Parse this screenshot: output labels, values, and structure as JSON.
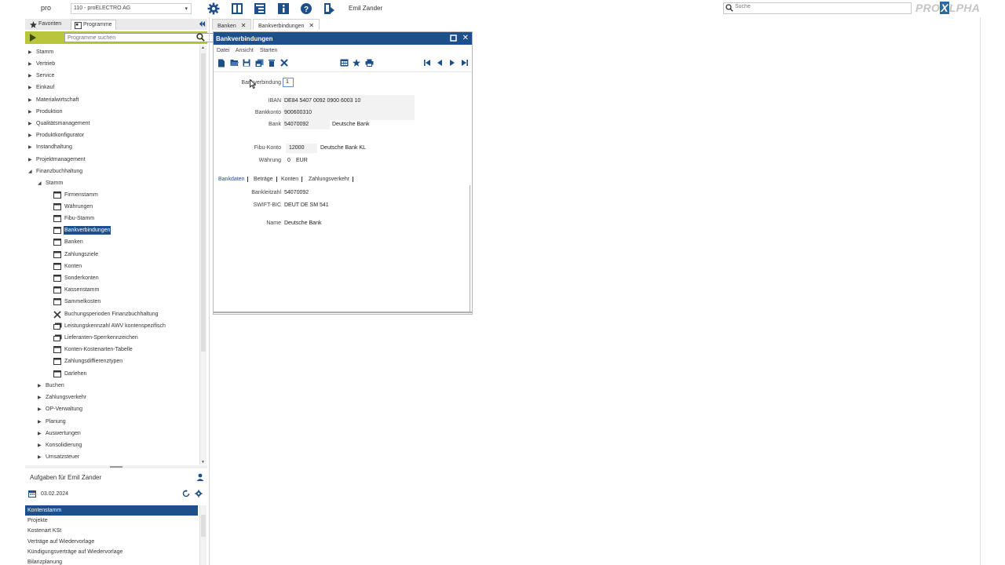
{
  "app": {
    "logo_text": "pro",
    "company": "110 - proELECTRO AG",
    "user": "Emil Zander",
    "search_placeholder": "Suche",
    "brand_left": "PRO",
    "brand_mid": "X",
    "brand_right": "LPHA"
  },
  "left_tabs": {
    "favorites": "Favoriten",
    "programs": "Programme"
  },
  "program_search": {
    "placeholder": "Programme suchen"
  },
  "tree": {
    "top": [
      "Stamm",
      "Vertrieb",
      "Service",
      "Einkauf",
      "Materialwirtschaft",
      "Produktion",
      "Qualitätsmanagement",
      "Produktkonfigurator",
      "Instandhaltung",
      "Projektmanagement"
    ],
    "finance": "Finanzbuchhaltung",
    "stamm": "Stamm",
    "leaves": [
      "Firmenstamm",
      "Währungen",
      "Fibu-Stamm",
      "Bankverbindungen",
      "Banken",
      "Zahlungsziele",
      "Konten",
      "Sonderkonten",
      "Kassenstamm",
      "Sammelkosten",
      "Buchungsperioden Finanzbuchhaltung",
      "Leistungskennzahl AWV kontenspezifisch",
      "Lieferanten-Sperrkennzeichen",
      "Konten-Kostenarten-Tabelle",
      "Zahlungsdiffierenztypen",
      "Darlehen"
    ],
    "after": [
      "Buchen",
      "Zahlungsverkehr",
      "OP-Verwaltung",
      "Planung",
      "Auswertungen",
      "Konsolidierung",
      "Umsatzsteuer"
    ]
  },
  "tasks": {
    "header": "Aufgaben für Emil Zander",
    "date": "03.02.2024",
    "items": [
      "Kontenstamm",
      "Projekte",
      "Kostenart KSt",
      "Verträge auf Wiedervorlage",
      "Kündigungsverträge auf Wiedervorlage",
      "Bilanzplanung"
    ]
  },
  "doc_tabs": {
    "tab1": "Banken",
    "tab2": "Bankverbindungen"
  },
  "window": {
    "title": "Bankverbindungen",
    "menu": [
      "Datei",
      "Ansicht",
      "Starten"
    ]
  },
  "form": {
    "bankverbindung_label": "Bankverbindung",
    "bankverbindung_value": "1",
    "iban_label": "IBAN",
    "iban_value": "DE84 5407 0092 0900 6003 10",
    "bankkonto_label": "Bankkonto",
    "bankkonto_value": "900600310",
    "bank_label": "Bank",
    "bank_code": "54070092",
    "bank_name": "Deutsche Bank",
    "fibu_label": "Fibu-Konto",
    "fibu_value": "12000",
    "fibu_name": "Deutsche Bank KL",
    "waehrung_label": "Währung",
    "waehrung_code": "0",
    "waehrung_name": "EUR"
  },
  "sub_tabs": [
    "Bankdaten",
    "Beträge",
    "Konten",
    "Zahlungsverkehr"
  ],
  "bankdaten": {
    "blz_label": "Bankleitzahl",
    "blz_value": "54070092",
    "swift_label": "SWIFT-BIC",
    "swift_value": "DEUT DE SM 541",
    "name_label": "Name",
    "name_value": "Deutsche Bank"
  },
  "colors": {
    "accent": "#1d4f8a",
    "search_bar": "#b9c63a"
  }
}
